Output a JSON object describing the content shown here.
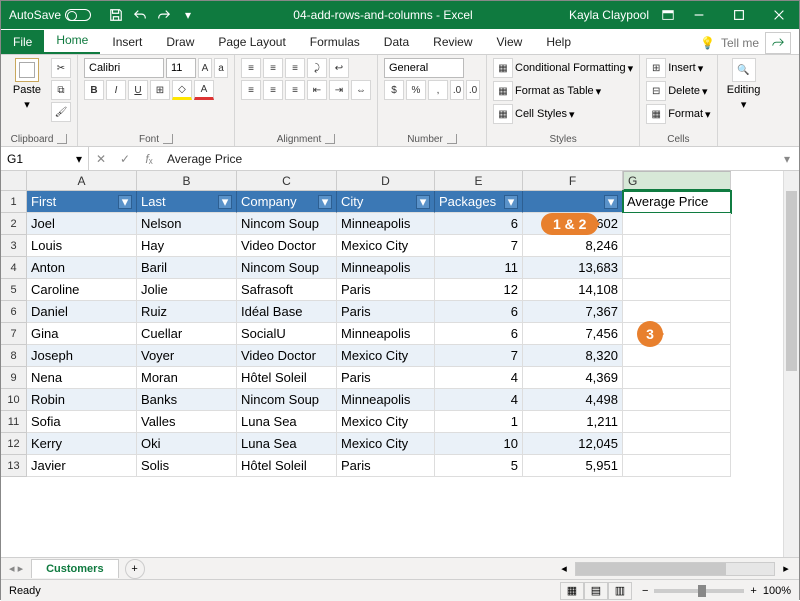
{
  "titlebar": {
    "autosave_label": "AutoSave",
    "doc_title": "04-add-rows-and-columns - Excel",
    "user": "Kayla Claypool"
  },
  "tabs": {
    "file": "File",
    "home": "Home",
    "insert": "Insert",
    "draw": "Draw",
    "page_layout": "Page Layout",
    "formulas": "Formulas",
    "data": "Data",
    "review": "Review",
    "view": "View",
    "help": "Help",
    "tell_me": "Tell me"
  },
  "ribbon": {
    "clipboard": {
      "label": "Clipboard",
      "paste": "Paste"
    },
    "font": {
      "label": "Font",
      "name": "Calibri",
      "size": "11",
      "bold": "B",
      "italic": "I",
      "underline": "U"
    },
    "alignment": {
      "label": "Alignment"
    },
    "number": {
      "label": "Number",
      "format": "General"
    },
    "styles": {
      "label": "Styles",
      "cond": "Conditional Formatting",
      "table": "Format as Table",
      "cells": "Cell Styles"
    },
    "cells_group": {
      "label": "Cells",
      "insert": "Insert",
      "delete": "Delete",
      "format": "Format"
    },
    "editing": {
      "label": "Editing"
    }
  },
  "name_box": "G1",
  "formula_value": "Average Price",
  "columns": [
    "A",
    "B",
    "C",
    "D",
    "E",
    "F",
    "G"
  ],
  "headers": [
    "First",
    "Last",
    "Company",
    "City",
    "Packages",
    ""
  ],
  "rows": [
    {
      "n": 1
    },
    {
      "n": 2,
      "first": "Joel",
      "last": "Nelson",
      "company": "Nincom Soup",
      "city": "Minneapolis",
      "packages": "6",
      "val": "6,602"
    },
    {
      "n": 3,
      "first": "Louis",
      "last": "Hay",
      "company": "Video Doctor",
      "city": "Mexico City",
      "packages": "7",
      "val": "8,246"
    },
    {
      "n": 4,
      "first": "Anton",
      "last": "Baril",
      "company": "Nincom Soup",
      "city": "Minneapolis",
      "packages": "11",
      "val": "13,683"
    },
    {
      "n": 5,
      "first": "Caroline",
      "last": "Jolie",
      "company": "Safrasoft",
      "city": "Paris",
      "packages": "12",
      "val": "14,108"
    },
    {
      "n": 6,
      "first": "Daniel",
      "last": "Ruiz",
      "company": "Idéal Base",
      "city": "Paris",
      "packages": "6",
      "val": "7,367"
    },
    {
      "n": 7,
      "first": "Gina",
      "last": "Cuellar",
      "company": "SocialU",
      "city": "Minneapolis",
      "packages": "6",
      "val": "7,456"
    },
    {
      "n": 8,
      "first": "Joseph",
      "last": "Voyer",
      "company": "Video Doctor",
      "city": "Mexico City",
      "packages": "7",
      "val": "8,320"
    },
    {
      "n": 9,
      "first": "Nena",
      "last": "Moran",
      "company": "Hôtel Soleil",
      "city": "Paris",
      "packages": "4",
      "val": "4,369"
    },
    {
      "n": 10,
      "first": "Robin",
      "last": "Banks",
      "company": "Nincom Soup",
      "city": "Minneapolis",
      "packages": "4",
      "val": "4,498"
    },
    {
      "n": 11,
      "first": "Sofia",
      "last": "Valles",
      "company": "Luna Sea",
      "city": "Mexico City",
      "packages": "1",
      "val": "1,211"
    },
    {
      "n": 12,
      "first": "Kerry",
      "last": "Oki",
      "company": "Luna Sea",
      "city": "Mexico City",
      "packages": "10",
      "val": "12,045"
    },
    {
      "n": 13,
      "first": "Javier",
      "last": "Solis",
      "company": "Hôtel Soleil",
      "city": "Paris",
      "packages": "5",
      "val": "5,951"
    }
  ],
  "g1_value": "Average Price",
  "sheet": {
    "name": "Customers"
  },
  "status": {
    "ready": "Ready",
    "zoom": "100%"
  },
  "callouts": {
    "one": "1 & 2",
    "three": "3"
  }
}
